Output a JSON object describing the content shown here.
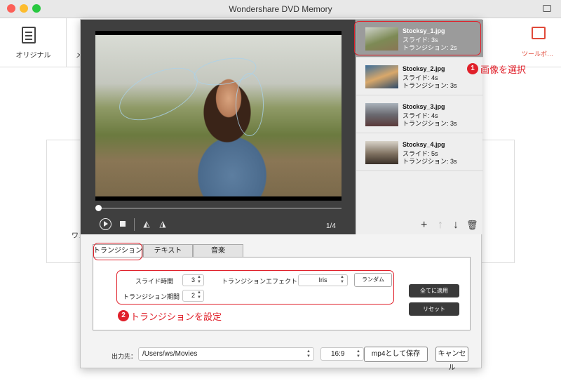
{
  "window": {
    "title": "Wondershare DVD Memory"
  },
  "background": {
    "step1_label": "オリジナル",
    "step2_label": "メ",
    "toolbox_label": "ツールボ…",
    "panel_label": "ワン"
  },
  "preview": {
    "counter": "1/4"
  },
  "images": [
    {
      "name": "Stocksy_1.jpg",
      "slide": "スライド: 3s",
      "transition": "トランジション: 2s"
    },
    {
      "name": "Stocksy_2.jpg",
      "slide": "スライド: 4s",
      "transition": "トランジション: 3s"
    },
    {
      "name": "Stocksy_3.jpg",
      "slide": "スライド: 4s",
      "transition": "トランジション: 3s"
    },
    {
      "name": "Stocksy_4.jpg",
      "slide": "スライド: 5s",
      "transition": "トランジション: 3s"
    }
  ],
  "list_tools": {
    "add": "+",
    "up": "↑",
    "down": "↓",
    "delete": "🗑"
  },
  "tabs": [
    "トランジション",
    "テキスト",
    "音楽"
  ],
  "settings": {
    "slide_time_label": "スライド時間",
    "slide_time_value": "3",
    "transition_duration_label": "トランジション期間",
    "transition_duration_value": "2",
    "transition_effect_label": "トランジションエフェクト",
    "transition_effect_value": "Iris",
    "random_button": "ランダム",
    "apply_all_button": "全てに適用",
    "reset_button": "リセット"
  },
  "annotations": {
    "step1_number": "1",
    "step1_text": "画像を選択",
    "step2_number": "2",
    "step2_text": "トランジションを設定"
  },
  "footer": {
    "output_label": "出力先：",
    "output_path": "/Users/ws/Movies",
    "aspect_ratio": "16:9",
    "save_button": "mp4として保存",
    "cancel_button": "キャンセル"
  },
  "colors": {
    "annotation_red": "#e0202a",
    "preview_bg": "#3f3f3f",
    "selected_item": "#9b9b9b"
  }
}
